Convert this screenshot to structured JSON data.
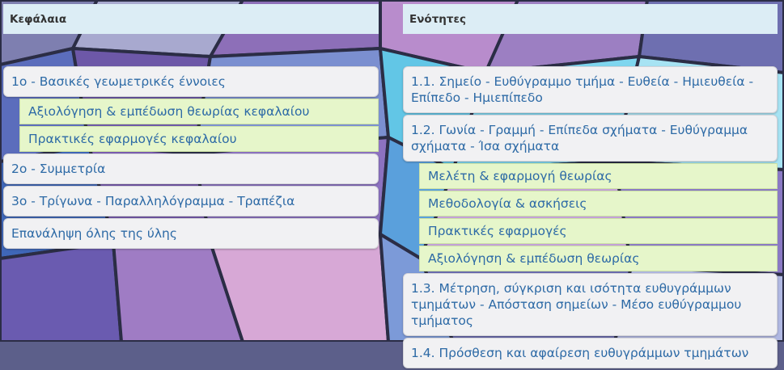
{
  "chapters": {
    "header": "Κεφάλαια",
    "items": [
      {
        "label": "1ο - Βασικές γεωμετρικές έννοιες",
        "subitems": [
          "Αξιολόγηση & εμπέδωση θεωρίας κεφαλαίου",
          "Πρακτικές εφαρμογές κεφαλαίου"
        ]
      },
      {
        "label": "2ο - Συμμετρία",
        "subitems": []
      },
      {
        "label": "3ο - Τρίγωνα - Παραλληλόγραμμα - Τραπέζια",
        "subitems": []
      },
      {
        "label": "Επανάληψη όλης της ύλης",
        "subitems": []
      }
    ]
  },
  "sections": {
    "header": "Ενότητες",
    "items": [
      {
        "label": "1.1. Σημείο - Ευθύγραμμο τμήμα - Ευθεία - Ημιευθεία - Επίπεδο - Ημιεπίπεδο",
        "subitems": []
      },
      {
        "label": "1.2. Γωνία - Γραμμή - Επίπεδα σχήματα - Ευθύγραμμα σχήματα - Ίσα σχήματα",
        "subitems": [
          "Μελέτη & εφαρμογή θεωρίας",
          "Μεθοδολογία & ασκήσεις",
          "Πρακτικές εφαρμογές",
          "Αξιολόγηση & εμπέδωση θεωρίας"
        ]
      },
      {
        "label": "1.3. Μέτρηση, σύγκριση και ισότητα ευθυγράμμων τμημάτων - Απόσταση σημείων - Μέσο ευθύγραμμου τμήματος",
        "subitems": []
      },
      {
        "label": "1.4. Πρόσθεση και αφαίρεση ευθυγράμμων τμημάτων",
        "subitems": []
      }
    ]
  },
  "colors": {
    "header_bg": "#dcedf5",
    "item_bg": "#f1f1f3",
    "subitem_bg": "#e6f6ca",
    "link_text": "#2d6aa6"
  }
}
